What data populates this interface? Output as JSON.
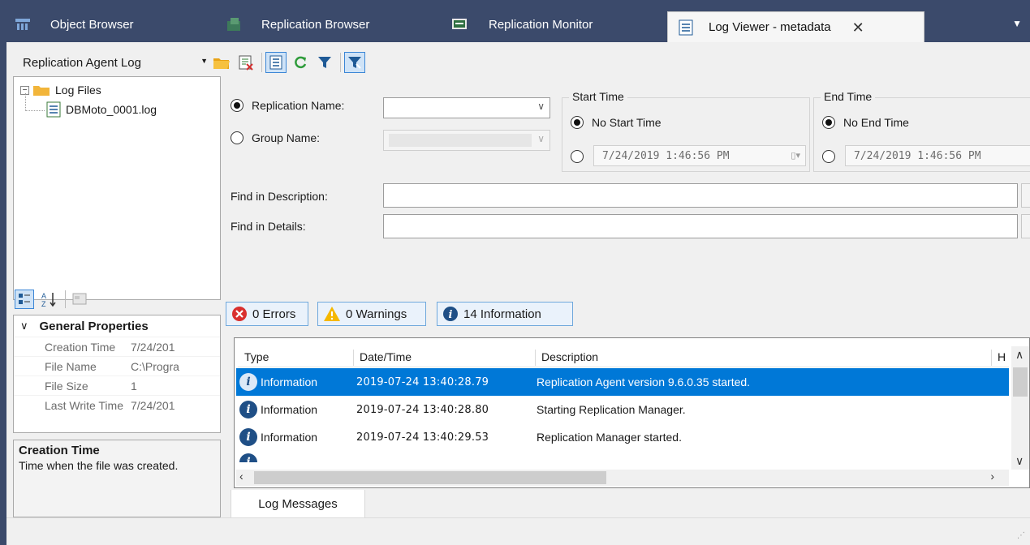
{
  "tabs": [
    {
      "label": "Object Browser",
      "icon": "object-browser-icon",
      "active": false
    },
    {
      "label": "Replication Browser",
      "icon": "replication-browser-icon",
      "active": false
    },
    {
      "label": "Replication Monitor",
      "icon": "replication-monitor-icon",
      "active": false
    },
    {
      "label": "Log Viewer - metadata",
      "icon": "log-viewer-icon",
      "active": true
    }
  ],
  "toolbar": {
    "log_type_value": "Replication Agent Log",
    "buttons": [
      "open-folder-icon",
      "clear-log-icon",
      "log-messages-icon",
      "refresh-icon",
      "filter-icon",
      "clear-filter-icon"
    ]
  },
  "tree": {
    "root_label": "Log Files",
    "child_label": "DBMoto_0001.log"
  },
  "properties": {
    "section_title": "General Properties",
    "rows": [
      {
        "key": "Creation Time",
        "value": "7/24/201"
      },
      {
        "key": "File Name",
        "value": "C:\\Progra"
      },
      {
        "key": "File Size",
        "value": "1"
      },
      {
        "key": "Last Write Time",
        "value": "7/24/201"
      }
    ]
  },
  "description": {
    "title": "Creation Time",
    "text": "Time when the file was created."
  },
  "filters": {
    "replication_name_label": "Replication Name:",
    "replication_name_value": "",
    "group_name_label": "Group Name:",
    "start_time_title": "Start Time",
    "no_start_time_label": "No Start Time",
    "start_time_value": "7/24/2019  1:46:56 PM",
    "end_time_title": "End Time",
    "no_end_time_label": "No End Time",
    "end_time_value": "7/24/2019  1:46:56 PM",
    "find_description_label": "Find in Description:",
    "find_description_value": "",
    "find_details_label": "Find in Details:",
    "find_details_value": ""
  },
  "severity": {
    "errors_label": "0 Errors",
    "warnings_label": "0 Warnings",
    "information_label": "14 Information"
  },
  "grid": {
    "columns": [
      "Type",
      "Date/Time",
      "Description",
      "H"
    ],
    "rows": [
      {
        "type": "Information",
        "datetime": "2019-07-24 13:40:28.79",
        "description": "Replication Agent version 9.6.0.35 started.",
        "selected": true
      },
      {
        "type": "Information",
        "datetime": "2019-07-24 13:40:28.80",
        "description": "Starting Replication Manager.",
        "selected": false
      },
      {
        "type": "Information",
        "datetime": "2019-07-24 13:40:29.53",
        "description": "Replication Manager started.",
        "selected": false
      }
    ]
  },
  "bottom_tab": {
    "label": "Log Messages"
  },
  "colors": {
    "frame": "#3b4a6b",
    "selection": "#0078d7",
    "error": "#d9302f",
    "warning": "#f5b800",
    "info": "#1f4f86"
  }
}
